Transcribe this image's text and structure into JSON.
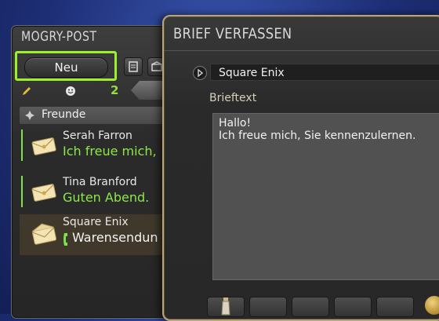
{
  "mogry_window": {
    "title": "MOGRY-POST",
    "new_button_label": "Neu",
    "tab_count": "2",
    "friends_label": "Freunde",
    "mails": [
      {
        "sender": "Serah Farron",
        "preview": "Ich freue mich,"
      },
      {
        "sender": "Tina Branford",
        "preview": "Guten Abend."
      },
      {
        "sender": "Square Enix",
        "preview": "Warensendun"
      }
    ]
  },
  "compose_window": {
    "title": "BRIEF VERFASSEN",
    "recipient": "Square Enix",
    "body_label": "Brieftext",
    "body_lines": [
      "Hallo!",
      "Ich freue mich, Sie kennenzulernen."
    ]
  },
  "colors": {
    "highlight_green": "#9cf02a",
    "preview_green": "#8ce84a",
    "frame_gold": "#b9a57a"
  }
}
